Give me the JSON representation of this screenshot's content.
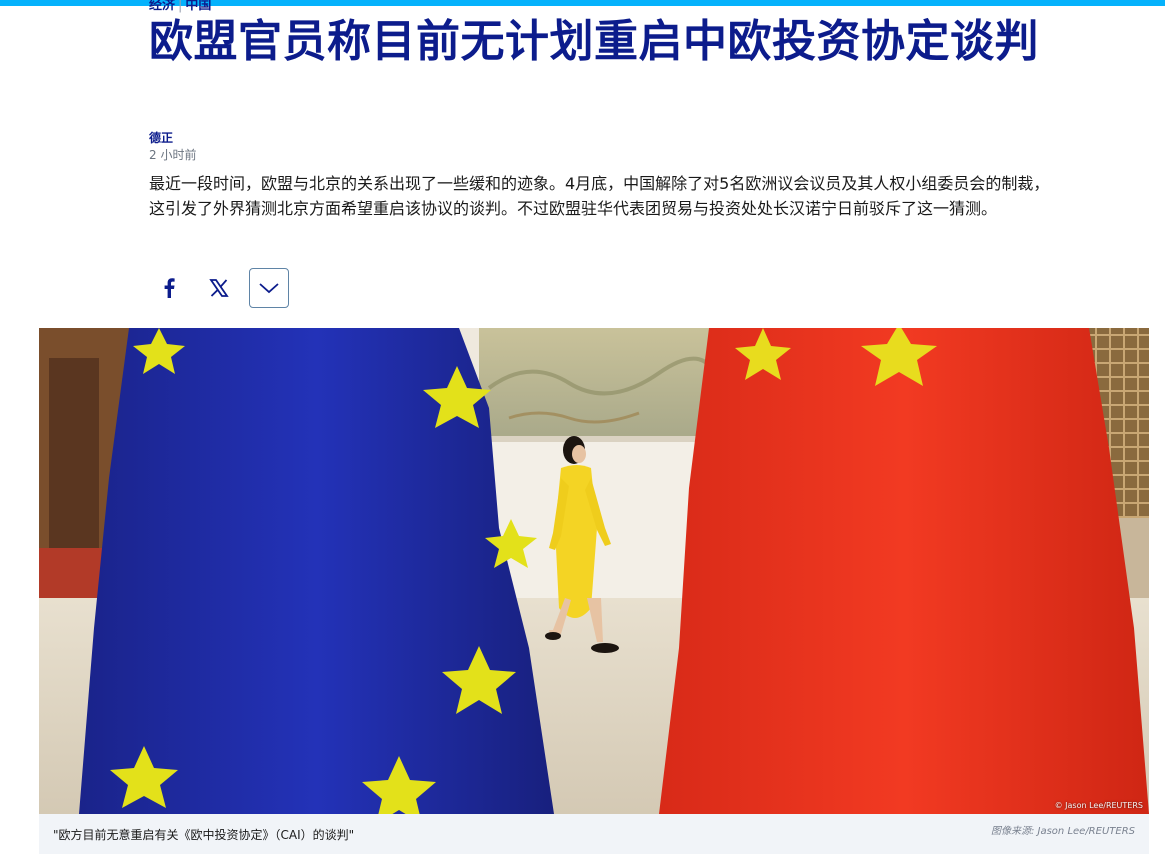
{
  "article": {
    "category": "经济",
    "region": "中国",
    "headline": "欧盟官员称目前无计划重启中欧投资协定谈判",
    "author": "德正",
    "published": "2 小时前",
    "lead": "最近一段时间，欧盟与北京的关系出现了一些缓和的迹象。4月底，中国解除了对5名欧洲议会议员及其人权小组委员会的制裁，这引发了外界猜测北京方面希望重启该协议的谈判。不过欧盟驻华代表团贸易与投资处处长汉诺宁日前驳斥了这一猜测。"
  },
  "share": {
    "facebook_icon": "facebook-icon",
    "x_icon": "x-icon",
    "more_icon": "chevron-down-icon"
  },
  "image": {
    "overlay_credit": "© Jason Lee/REUTERS",
    "caption": "\"欧方目前无意重启有关《欧中投资协定》（CAI）的谈判\"",
    "credit": "图像来源: Jason Lee/REUTERS"
  },
  "colors": {
    "accent_bar": "#05b2fc",
    "headline": "#0c1c8c",
    "eu_flag": "#1d2aa6",
    "china_flag": "#e8321f",
    "star": "#e3e11a",
    "dress": "#f4d424"
  }
}
